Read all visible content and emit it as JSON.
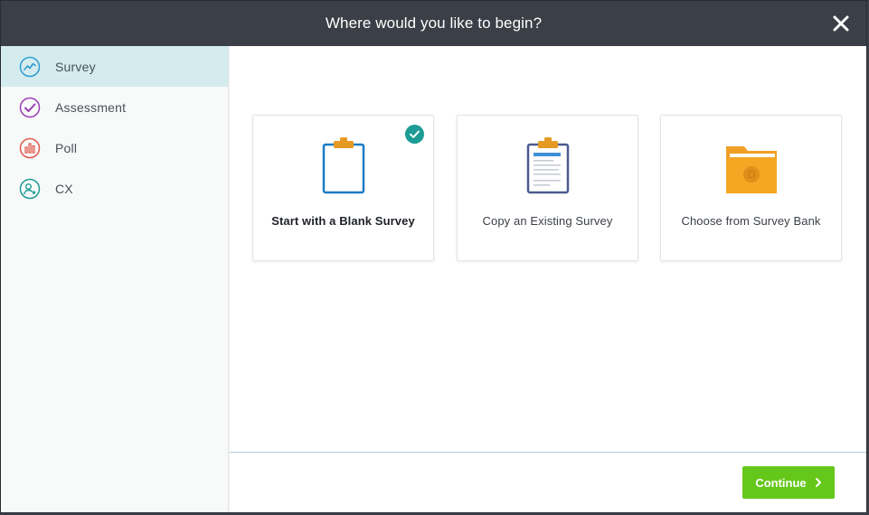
{
  "dialog": {
    "title": "Where would you like to begin?",
    "close_icon": "close-icon"
  },
  "sidebar": {
    "items": [
      {
        "label": "Survey",
        "icon": "survey-trend-icon",
        "color": "#2f9bd1",
        "active": true
      },
      {
        "label": "Assessment",
        "icon": "assessment-check-icon",
        "color": "#9b3bb5",
        "active": false
      },
      {
        "label": "Poll",
        "icon": "poll-bars-icon",
        "color": "#e2574c",
        "active": false
      },
      {
        "label": "CX",
        "icon": "cx-person-icon",
        "color": "#1c9c95",
        "active": false
      }
    ]
  },
  "options": [
    {
      "label": "Start with a Blank Survey",
      "icon": "blank-clipboard-icon",
      "selected": true
    },
    {
      "label": "Copy an Existing Survey",
      "icon": "filled-clipboard-icon",
      "selected": false
    },
    {
      "label": "Choose from Survey Bank",
      "icon": "folder-icon",
      "selected": false
    }
  ],
  "footer": {
    "continue_label": "Continue"
  },
  "colors": {
    "header_bg": "#3b3f47",
    "active_bg": "#d4ecee",
    "accent_teal": "#1c9c95",
    "continue_green": "#66c71b",
    "clipboard_orange": "#e69a24",
    "folder_orange": "#f5a623"
  }
}
